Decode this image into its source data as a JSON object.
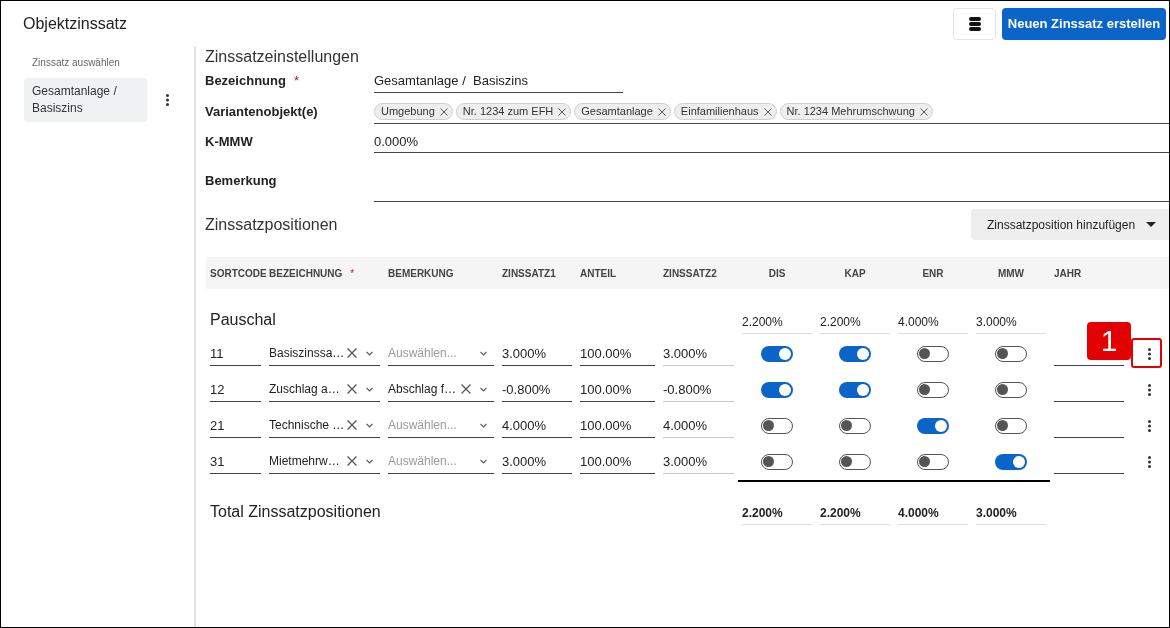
{
  "header": {
    "title": "Objektzinssatz",
    "create_button": "Neuen Zinssatz erstellen"
  },
  "sidebar": {
    "heading": "Zinssatz auswählen",
    "items": [
      {
        "label": "Gesamtanlage / Basiszins",
        "selected": true
      }
    ]
  },
  "settings": {
    "title": "Zinssatzeinstellungen",
    "fields": [
      {
        "kind": "text",
        "label": "Bezeichnung",
        "required_mark": "*",
        "value": "Gesamtanlage /  Basiszins"
      },
      {
        "kind": "chips",
        "label": "Variantenobjekt(e)",
        "chips": [
          "Umgebung",
          "Nr. 1234 zum EFH",
          "Gesamtanlage",
          "Einfamilienhaus",
          "Nr. 1234 Mehrumschwung"
        ]
      },
      {
        "kind": "number",
        "label": "K-MMW",
        "value": "0.000%"
      },
      {
        "kind": "textarea",
        "label": "Bemerkung"
      }
    ]
  },
  "positions": {
    "title": "Zinssatzpositionen",
    "add_button": "Zinssatzposition hinzufügen",
    "callout_label": "1",
    "table": {
      "columns": [
        {
          "label": "SORTCODE",
          "kind": "field"
        },
        {
          "label": "BEZEICHNUNG",
          "kind": "field",
          "required_mark": "*"
        },
        {
          "label": "BEMERKUNG",
          "kind": "field"
        },
        {
          "label": "ZINSSATZ1",
          "kind": "field"
        },
        {
          "label": "ANTEIL",
          "kind": "field"
        },
        {
          "label": "ZINSSATZ2",
          "kind": "field"
        },
        {
          "label": "DIS",
          "kind": "switch"
        },
        {
          "label": "KAP",
          "kind": "switch"
        },
        {
          "label": "ENR",
          "kind": "switch"
        },
        {
          "label": "MMW",
          "kind": "switch"
        },
        {
          "label": "JAHR",
          "kind": "field"
        }
      ],
      "groups": [
        {
          "title": "Pauschal",
          "totals": [
            "2.200%",
            "2.200%",
            "4.000%",
            "3.000%"
          ],
          "rows": [
            {
              "highlighted": true,
              "cells": [
                {
                  "kind": "input",
                  "value": "11"
                },
                {
                  "kind": "select",
                  "value": "Basiszinssa…"
                },
                {
                  "kind": "select",
                  "placeholder": "Auswählen..."
                },
                {
                  "kind": "input",
                  "value": "3.000%"
                },
                {
                  "kind": "input",
                  "value": "100.00%"
                },
                {
                  "kind": "readonly",
                  "value": "3.000%"
                },
                {
                  "kind": "switch",
                  "on": true
                },
                {
                  "kind": "switch",
                  "on": true
                },
                {
                  "kind": "switch",
                  "on": false
                },
                {
                  "kind": "switch",
                  "on": false
                },
                {
                  "kind": "input"
                }
              ]
            },
            {
              "highlighted": false,
              "cells": [
                {
                  "kind": "input",
                  "value": "12"
                },
                {
                  "kind": "select",
                  "value": "Zuschlag a…"
                },
                {
                  "kind": "select",
                  "value": "Abschlag f…"
                },
                {
                  "kind": "input",
                  "value": "-0.800%"
                },
                {
                  "kind": "input",
                  "value": "100.00%"
                },
                {
                  "kind": "readonly",
                  "value": "-0.800%"
                },
                {
                  "kind": "switch",
                  "on": true
                },
                {
                  "kind": "switch",
                  "on": true
                },
                {
                  "kind": "switch",
                  "on": false
                },
                {
                  "kind": "switch",
                  "on": false
                },
                {
                  "kind": "input"
                }
              ]
            },
            {
              "highlighted": false,
              "cells": [
                {
                  "kind": "input",
                  "value": "21"
                },
                {
                  "kind": "select",
                  "value": "Technische …"
                },
                {
                  "kind": "select",
                  "placeholder": "Auswählen..."
                },
                {
                  "kind": "input",
                  "value": "4.000%"
                },
                {
                  "kind": "input",
                  "value": "100.00%"
                },
                {
                  "kind": "readonly",
                  "value": "4.000%"
                },
                {
                  "kind": "switch",
                  "on": false
                },
                {
                  "kind": "switch",
                  "on": false
                },
                {
                  "kind": "switch",
                  "on": true
                },
                {
                  "kind": "switch",
                  "on": false
                },
                {
                  "kind": "input"
                }
              ]
            },
            {
              "highlighted": false,
              "cells": [
                {
                  "kind": "input",
                  "value": "31"
                },
                {
                  "kind": "select",
                  "value": "Mietmehrw…"
                },
                {
                  "kind": "select",
                  "placeholder": "Auswählen..."
                },
                {
                  "kind": "input",
                  "value": "3.000%"
                },
                {
                  "kind": "input",
                  "value": "100.00%"
                },
                {
                  "kind": "readonly",
                  "value": "3.000%"
                },
                {
                  "kind": "switch",
                  "on": false
                },
                {
                  "kind": "switch",
                  "on": false
                },
                {
                  "kind": "switch",
                  "on": false
                },
                {
                  "kind": "switch",
                  "on": true
                },
                {
                  "kind": "input"
                }
              ]
            }
          ]
        }
      ],
      "total": {
        "label": "Total Zinssatzpositionen",
        "values": [
          "2.200%",
          "2.200%",
          "4.000%",
          "3.000%"
        ]
      }
    }
  }
}
